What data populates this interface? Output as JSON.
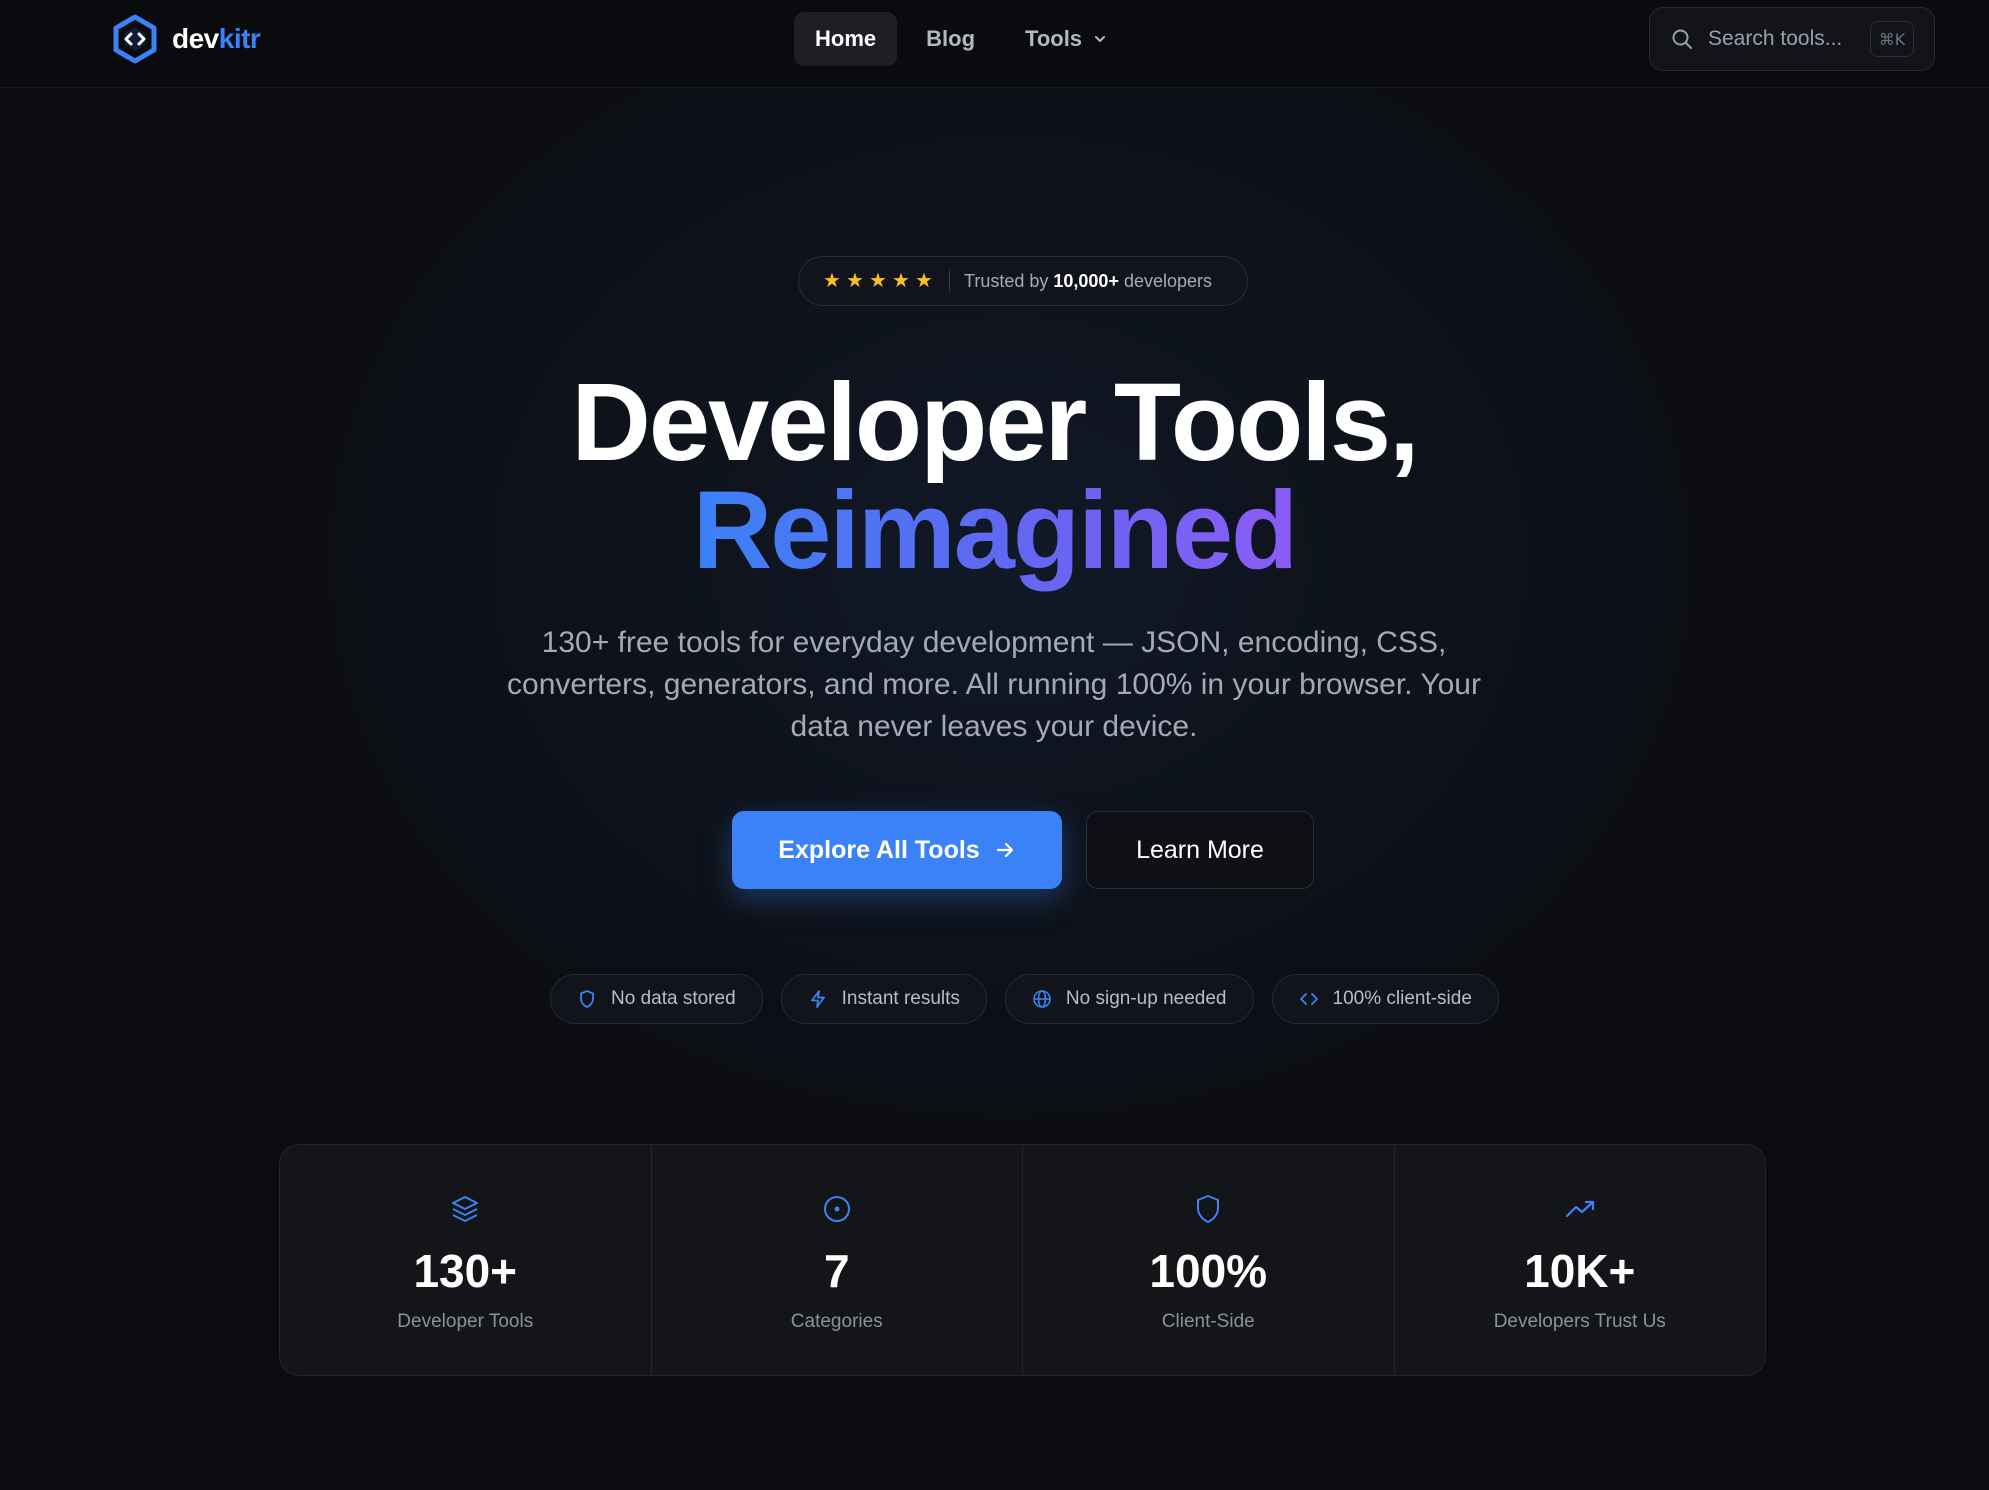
{
  "brand": {
    "prefix": "dev",
    "suffix": "kitr",
    "accent": "#3b82f6",
    "icon": "hex-code-icon"
  },
  "nav": {
    "items": [
      {
        "label": "Home",
        "active": true
      },
      {
        "label": "Blog",
        "active": false
      },
      {
        "label": "Tools",
        "active": false,
        "icon": "chevron-down-icon"
      }
    ]
  },
  "search": {
    "placeholder": "Search tools...",
    "shortcut": "⌘K",
    "icon": "search-icon"
  },
  "trust": {
    "stars": 5,
    "prefix": "Trusted by",
    "count": "10,000+",
    "suffix": "developers",
    "star_color": "#fbbf24"
  },
  "hero": {
    "title_line1": "Developer Tools,",
    "title_line2": "Reimagined",
    "gradient": [
      "#3b82f6",
      "#8b5cf6"
    ],
    "subtitle": "130+ free tools for everyday development — JSON, encoding, CSS, converters, generators, and more. All running 100% in your browser. Your data never leaves your device."
  },
  "cta": {
    "primary_label": "Explore All Tools",
    "primary_icon": "arrow-right-icon",
    "secondary_label": "Learn More"
  },
  "features": [
    {
      "icon": "shield-icon",
      "label": "No data stored"
    },
    {
      "icon": "zap-icon",
      "label": "Instant results"
    },
    {
      "icon": "globe-icon",
      "label": "No sign-up needed"
    },
    {
      "icon": "code-icon",
      "label": "100% client-side"
    }
  ],
  "stats": [
    {
      "icon": "layers-icon",
      "value": "130+",
      "label": "Developer Tools"
    },
    {
      "icon": "target-icon",
      "value": "7",
      "label": "Categories"
    },
    {
      "icon": "shield-icon",
      "value": "100%",
      "label": "Client-Side"
    },
    {
      "icon": "trending-up-icon",
      "value": "10K+",
      "label": "Developers Trust Us"
    }
  ]
}
